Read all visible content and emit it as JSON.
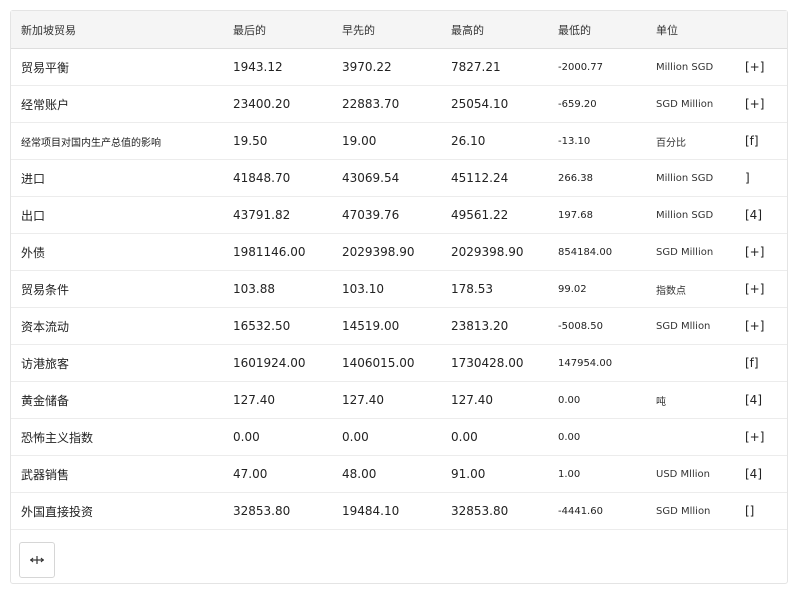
{
  "table": {
    "headers": [
      "新加坡贸易",
      "最后的",
      "早先的",
      "最高的",
      "最低的",
      "单位"
    ],
    "rows": [
      {
        "name": "贸易平衡",
        "last": "1943.12",
        "previous": "3970.22",
        "highest": "7827.21",
        "lowest": "-2000.77",
        "unit": "Million SGD",
        "action": "[+]"
      },
      {
        "name": "经常账户",
        "last": "23400.20",
        "previous": "22883.70",
        "highest": "25054.10",
        "lowest": "-659.20",
        "unit": "SGD Million",
        "action": "[+]"
      },
      {
        "name": "经常项目对国内生产总值的影响",
        "last": "19.50",
        "previous": "19.00",
        "highest": "26.10",
        "lowest": "-13.10",
        "unit": "百分比",
        "action": "[f]"
      },
      {
        "name": "进口",
        "last": "41848.70",
        "previous": "43069.54",
        "highest": "45112.24",
        "lowest": "266.38",
        "unit": "Million SGD",
        "action": "]"
      },
      {
        "name": "出口",
        "last": "43791.82",
        "previous": "47039.76",
        "highest": "49561.22",
        "lowest": "197.68",
        "unit": "Million SGD",
        "action": "[4]"
      },
      {
        "name": "外债",
        "last": "1981146.00",
        "previous": "2029398.90",
        "highest": "2029398.90",
        "lowest": "854184.00",
        "unit": "SGD Million",
        "action": "[+]"
      },
      {
        "name": "贸易条件",
        "last": "103.88",
        "previous": "103.10",
        "highest": "178.53",
        "lowest": "99.02",
        "unit": "指数点",
        "action": "[+]"
      },
      {
        "name": "资本流动",
        "last": "16532.50",
        "previous": "14519.00",
        "highest": "23813.20",
        "lowest": "-5008.50",
        "unit": "SGD Mllion",
        "action": "[+]"
      },
      {
        "name": "访港旅客",
        "last": "1601924.00",
        "previous": "1406015.00",
        "highest": "1730428.00",
        "lowest": "147954.00",
        "unit": "",
        "action": "[f]"
      },
      {
        "name": "黄金储备",
        "last": "127.40",
        "previous": "127.40",
        "highest": "127.40",
        "lowest": "0.00",
        "unit": "吨",
        "action": "[4]"
      },
      {
        "name": "恐怖主义指数",
        "last": "0.00",
        "previous": "0.00",
        "highest": "0.00",
        "lowest": "0.00",
        "unit": "",
        "action": "[+]"
      },
      {
        "name": "武器销售",
        "last": "47.00",
        "previous": "48.00",
        "highest": "91.00",
        "lowest": "1.00",
        "unit": "USD Mllion",
        "action": "[4]"
      },
      {
        "name": "外国直接投资",
        "last": "32853.80",
        "previous": "19484.10",
        "highest": "32853.80",
        "lowest": "-4441.60",
        "unit": "SGD Mllion",
        "action": "[]"
      }
    ]
  },
  "footer": {
    "icon": "expand-icon"
  }
}
